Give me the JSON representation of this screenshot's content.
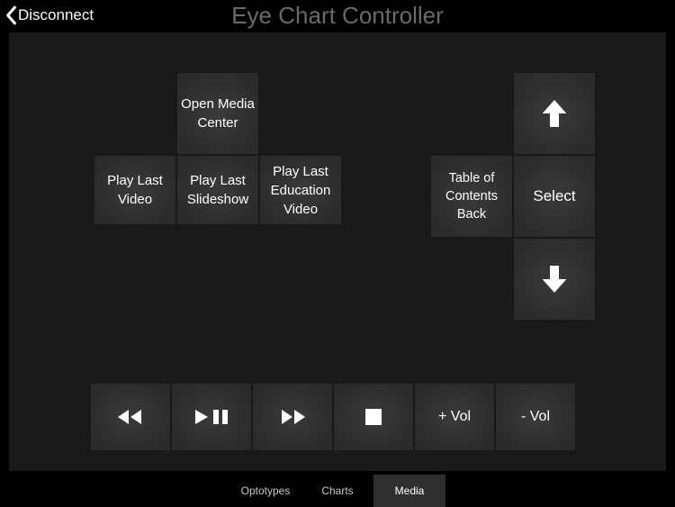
{
  "header": {
    "back_label": "Disconnect",
    "title": "Eye Chart Controller"
  },
  "media_grid": {
    "open_media_center": "Open Media Center",
    "play_last_video": "Play Last Video",
    "play_last_slideshow": "Play Last Slideshow",
    "play_last_education_video": "Play Last Education Video"
  },
  "nav_pad": {
    "toc_back": "Table of Contents Back",
    "select": "Select",
    "up_icon": "arrow-up",
    "down_icon": "arrow-down"
  },
  "playback": {
    "rewind_icon": "rewind",
    "playpause_icon": "play-pause",
    "forward_icon": "fast-forward",
    "stop_icon": "stop",
    "vol_up": "+ Vol",
    "vol_down": "- Vol"
  },
  "tabs": {
    "optotypes": "Optotypes",
    "charts": "Charts",
    "media": "Media",
    "active": "media"
  }
}
